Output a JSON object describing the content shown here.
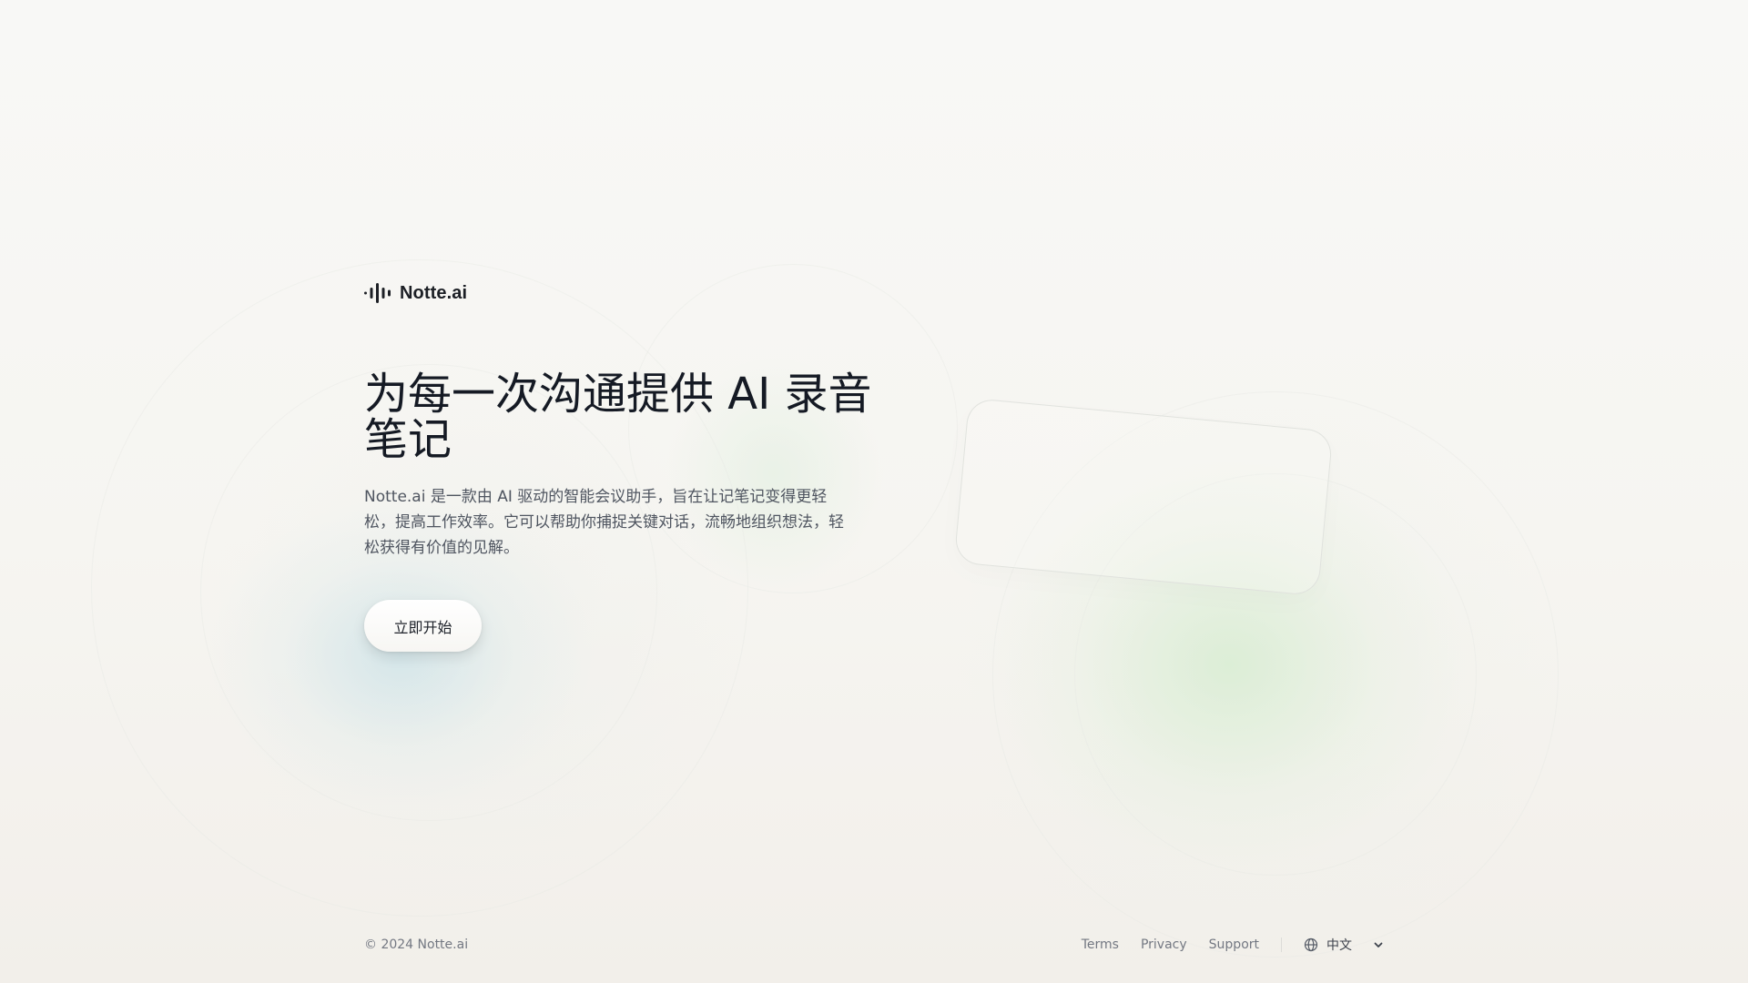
{
  "brand": {
    "name": "Notte.ai",
    "logo_icon": "audio-waveform-icon"
  },
  "hero": {
    "title": "为每一次沟通提供 AI 录音笔记",
    "description": "Notte.ai 是一款由 AI 驱动的智能会议助手，旨在让记笔记变得更轻松，提高工作效率。它可以帮助你捕捉关键对话，流畅地组织想法，轻松获得有价值的见解。",
    "cta_label": "立即开始"
  },
  "footer": {
    "copyright": "© 2024 Notte.ai",
    "links": [
      "Terms",
      "Privacy",
      "Support"
    ],
    "language": {
      "icon": "globe-icon",
      "selected": "中文",
      "dropdown_icon": "chevron-down-icon"
    }
  },
  "colors": {
    "text_primary": "#151a24",
    "text_secondary": "#4f5560",
    "footer_text": "#737882",
    "background": "#f6f5f1",
    "accent_blue_glow": "#cbe2e8",
    "accent_green_glow": "#d5ecd0"
  }
}
